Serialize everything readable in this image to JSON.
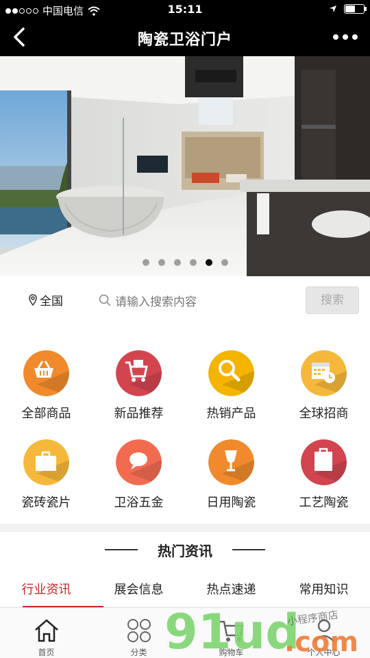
{
  "status": {
    "carrier": "中国电信",
    "time": "15:11"
  },
  "nav": {
    "title": "陶瓷卫浴门户"
  },
  "banner": {
    "slide_count": 6,
    "active_index": 4
  },
  "search": {
    "location": "全国",
    "placeholder": "请输入搜索内容",
    "button": "搜索"
  },
  "categories": [
    {
      "label": "全部商品",
      "icon": "basket-icon",
      "color": "#f08a2c"
    },
    {
      "label": "新品推荐",
      "icon": "cart-icon",
      "color": "#d2454f"
    },
    {
      "label": "热销产品",
      "icon": "search-icon",
      "color": "#f4b400"
    },
    {
      "label": "全球招商",
      "icon": "calendar-icon",
      "color": "#f6b83a"
    },
    {
      "label": "瓷砖瓷片",
      "icon": "briefcase-icon",
      "color": "#f6b83a"
    },
    {
      "label": "卫浴五金",
      "icon": "chat-icon",
      "color": "#f26b50"
    },
    {
      "label": "日用陶瓷",
      "icon": "glass-icon",
      "color": "#f08a2c"
    },
    {
      "label": "工艺陶瓷",
      "icon": "clipboard-icon",
      "color": "#d2454f"
    }
  ],
  "news": {
    "heading": "热门资讯",
    "tabs": [
      "行业资讯",
      "展会信息",
      "热点速递",
      "常用知识"
    ],
    "active_tab": 0
  },
  "tabbar": [
    {
      "label": "首页",
      "icon": "home-icon"
    },
    {
      "label": "分类",
      "icon": "grid-icon"
    },
    {
      "label": "购物车",
      "icon": "cart-icon"
    },
    {
      "label": "个人中心",
      "icon": "user-icon"
    }
  ],
  "watermark": {
    "brand": "91ud",
    "suffix": ".com",
    "script": "小程序商店"
  }
}
